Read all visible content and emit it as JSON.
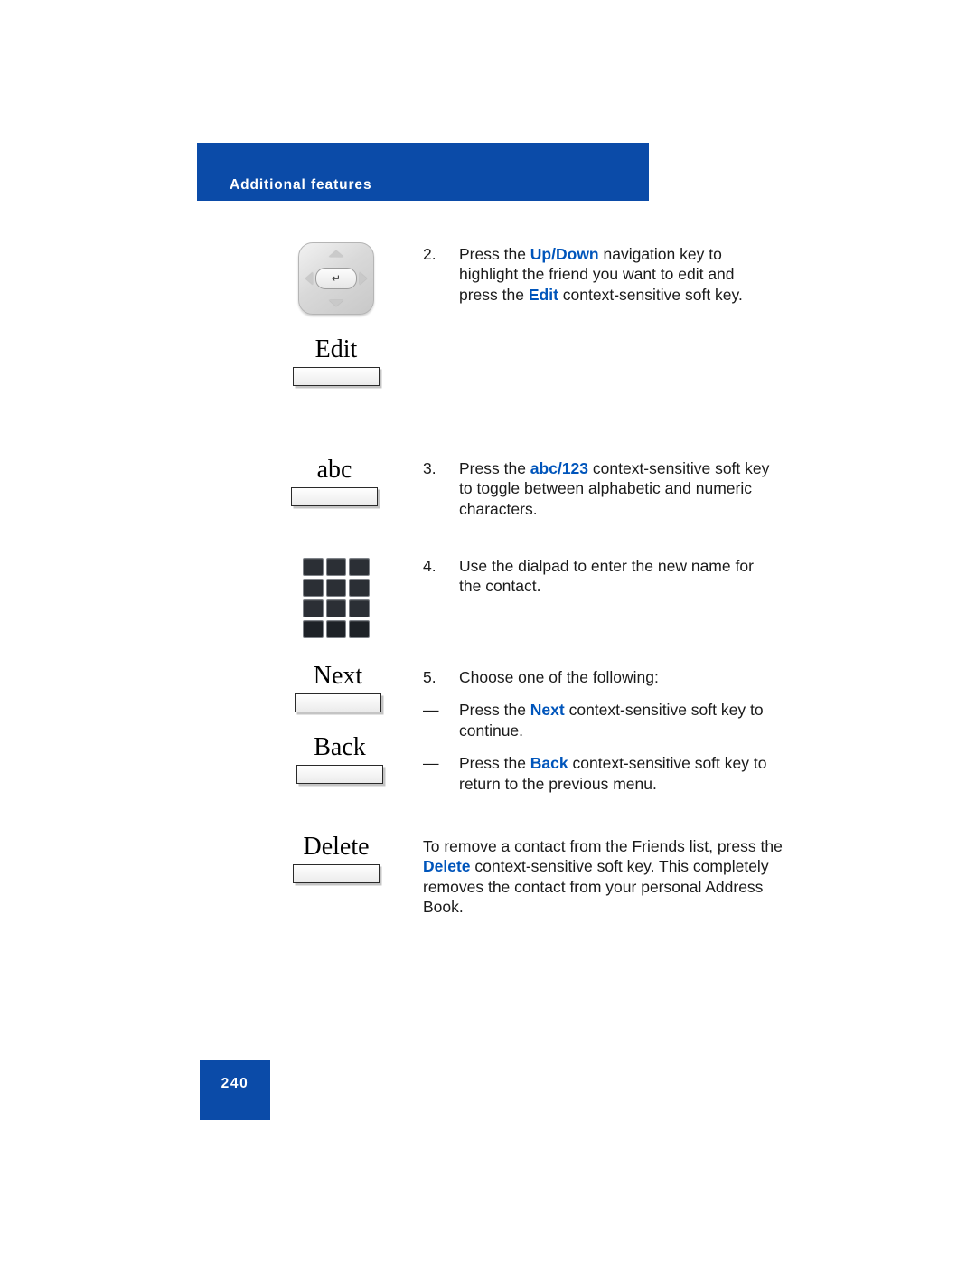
{
  "header": {
    "title": "Additional features"
  },
  "footer": {
    "page_number": "240"
  },
  "colors": {
    "header_blue": "#0B4BA8",
    "highlight_blue": "#0055BB",
    "page_background": "#FFFFFF",
    "text_black": "#1A1A1A"
  },
  "softkeys": {
    "edit": "Edit",
    "abc": "abc",
    "next": "Next",
    "back": "Back",
    "delete": "Delete"
  },
  "icons": {
    "navigation_key": "navigation-cluster-icon",
    "dialpad": "dialpad-icon",
    "enter_glyph": "↵"
  },
  "steps": [
    {
      "number": "2.",
      "segments": [
        {
          "text": "Press the ",
          "style": "plain"
        },
        {
          "text": "Up/Down",
          "style": "highlight"
        },
        {
          "text": " navigation key to highlight the friend you want to edit and press the ",
          "style": "plain"
        },
        {
          "text": "Edit",
          "style": "highlight"
        },
        {
          "text": " context-sensitive soft key.",
          "style": "plain"
        }
      ]
    },
    {
      "number": "3.",
      "segments": [
        {
          "text": "Press the ",
          "style": "plain"
        },
        {
          "text": "abc/123",
          "style": "highlight"
        },
        {
          "text": " context-sensitive soft key to toggle between alphabetic and numeric characters.",
          "style": "plain"
        }
      ]
    },
    {
      "number": "4.",
      "segments": [
        {
          "text": "Use the dialpad to enter the new name for the contact.",
          "style": "plain"
        }
      ]
    },
    {
      "number": "5.",
      "segments": [
        {
          "text": "Choose one of the following:",
          "style": "plain"
        }
      ],
      "sub_items": [
        {
          "marker": "—",
          "segments": [
            {
              "text": "Press the ",
              "style": "plain"
            },
            {
              "text": "Next",
              "style": "highlight"
            },
            {
              "text": " context-sensitive soft key to continue.",
              "style": "plain"
            }
          ]
        },
        {
          "marker": "—",
          "segments": [
            {
              "text": "Press the ",
              "style": "plain"
            },
            {
              "text": "Back",
              "style": "highlight"
            },
            {
              "text": " context-sensitive soft key to return to the previous menu.",
              "style": "plain"
            }
          ]
        }
      ]
    }
  ],
  "closing_paragraph": {
    "segments": [
      {
        "text": "To remove a contact from the Friends list, press the ",
        "style": "plain"
      },
      {
        "text": "Delete",
        "style": "highlight"
      },
      {
        "text": " context-sensitive soft key. This completely removes the contact from your personal Address Book.",
        "style": "plain"
      }
    ]
  }
}
